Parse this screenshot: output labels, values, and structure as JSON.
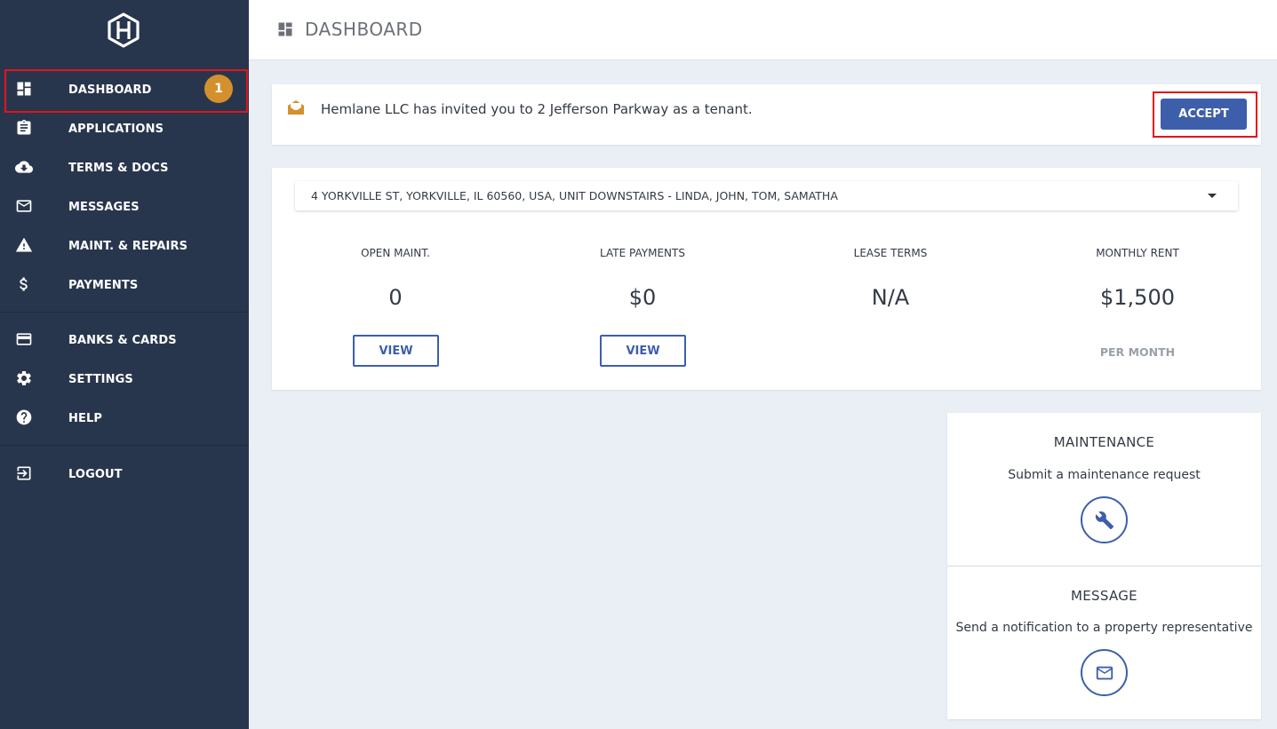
{
  "sidebar": {
    "logo_icon": "hexagon-h-logo",
    "items": [
      {
        "label": "DASHBOARD",
        "icon": "dashboard-icon",
        "badge": "1"
      },
      {
        "label": "APPLICATIONS",
        "icon": "clipboard-icon"
      },
      {
        "label": "TERMS & DOCS",
        "icon": "cloud-download-icon"
      },
      {
        "label": "MESSAGES",
        "icon": "mail-icon"
      },
      {
        "label": "MAINT. & REPAIRS",
        "icon": "warning-icon"
      },
      {
        "label": "PAYMENTS",
        "icon": "dollar-icon"
      },
      {
        "label": "BANKS & CARDS",
        "icon": "credit-card-icon"
      },
      {
        "label": "SETTINGS",
        "icon": "gear-icon"
      },
      {
        "label": "HELP",
        "icon": "help-icon"
      },
      {
        "label": "LOGOUT",
        "icon": "logout-icon"
      }
    ]
  },
  "header": {
    "title": "DASHBOARD",
    "icon": "dashboard-icon"
  },
  "invite": {
    "icon": "open-envelope-icon",
    "message": "Hemlane LLC has invited you to 2 Jefferson Parkway as a tenant.",
    "accept_label": "ACCEPT"
  },
  "property": {
    "selected": "4 YORKVILLE ST, YORKVILLE, IL 60560, USA, UNIT DOWNSTAIRS - LINDA, JOHN, TOM, SAMATHA"
  },
  "stats": [
    {
      "label": "OPEN MAINT.",
      "value": "0",
      "button": "VIEW"
    },
    {
      "label": "LATE PAYMENTS",
      "value": "$0",
      "button": "VIEW"
    },
    {
      "label": "LEASE TERMS",
      "value": "N/A"
    },
    {
      "label": "MONTHLY RENT",
      "value": "$1,500",
      "sub": "PER MONTH"
    }
  ],
  "actions": [
    {
      "title": "MAINTENANCE",
      "description": "Submit a maintenance request",
      "icon": "wrench-icon"
    },
    {
      "title": "MESSAGE",
      "description": "Send a notification to a property representative",
      "icon": "mail-icon"
    }
  ],
  "colors": {
    "sidebar_bg": "#28364d",
    "accent": "#3d5eab",
    "badge": "#d3902d",
    "highlight": "#e3131b",
    "page_bg": "#eaeef5"
  }
}
